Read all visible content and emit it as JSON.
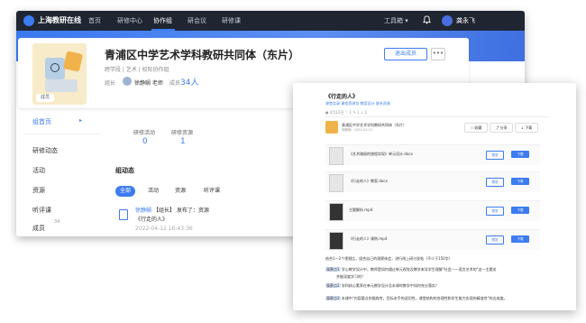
{
  "topbar": {
    "brand": "上海教研在线",
    "nav": [
      "首页",
      "研修中心",
      "协作组",
      "研会议",
      "研修课"
    ],
    "active_nav": "协作组",
    "tools": "工具箱 ▾",
    "user": "龚永飞"
  },
  "group": {
    "title": "青浦区中学艺术学科教研共同体（东片）",
    "subtitle": "跨学段 | 艺术 | 校际协作组",
    "leader_label": "组长",
    "leader_name": "徐静娴 老师",
    "member_label": "成员",
    "member_count": "34人",
    "join_button": "退出成员",
    "more_button": "•••",
    "cover_tag": "成员"
  },
  "sidebar": {
    "items": [
      "组首页",
      "研修动态",
      "活动",
      "资源",
      "听评课",
      "成员"
    ],
    "member_badge": "34"
  },
  "stats": [
    {
      "label": "研修活动",
      "value": "0"
    },
    {
      "label": "研修资源",
      "value": "1"
    }
  ],
  "feed": {
    "title": "组动态",
    "tabs": [
      "全部",
      "活动",
      "资源",
      "听评课"
    ],
    "author": "徐静娴",
    "line1_rest": "【组长】 发布了：资源",
    "line2": "《行走的人》",
    "time": "2022-04-12 16:43:36"
  },
  "doc": {
    "title": "《行走的人》",
    "tags": "课堂实录   课程资源包   教案设计   联系资源",
    "stats": "● 4月12日   ♡ 1   ✎ 1   ↓ 1",
    "group_name": "青浦区中学艺术学科教研共同体（东片）",
    "group_sub": "徐静娴 · 2022-04-12",
    "actions": [
      "☆ 收藏",
      "⤴ 分享",
      "↓ 下载"
    ],
    "files": [
      {
        "name": "《艺术瑰丽的旅程实现》单元设计.docx",
        "preview": "预览",
        "download": "下载"
      },
      {
        "name": "《行走的人》教案.docx",
        "preview": "预览",
        "download": "下载"
      },
      {
        "name": "主题解析.mp4",
        "preview": "预览",
        "download": "下载"
      },
      {
        "name": "《行走的人》课例.mp4",
        "preview": "预览",
        "download": "下载"
      }
    ],
    "intro": "结合1—2个视频比，组合自己的观察体会，进行线上研讨发帖（不少于150字）",
    "points": [
      {
        "tag": "观察点1",
        "text": "学心教学设计中，教师是如何通过单元视觉及教学来导学生理解\"社会——语言艺术的\"这一主题关"
      },
      {
        "tag": "",
        "text": "并能深度学习的？"
      },
      {
        "tag": "观察点2",
        "text": "学科核心素养在单元教学设计及本课时教学中如何充分落实？"
      },
      {
        "tag": "观察点3",
        "text": "本课中\"内容要点的锻炼性，目标本手的适切性，课堂结构的合理性和学生能力实现的精准性\"的达成度。"
      }
    ]
  }
}
